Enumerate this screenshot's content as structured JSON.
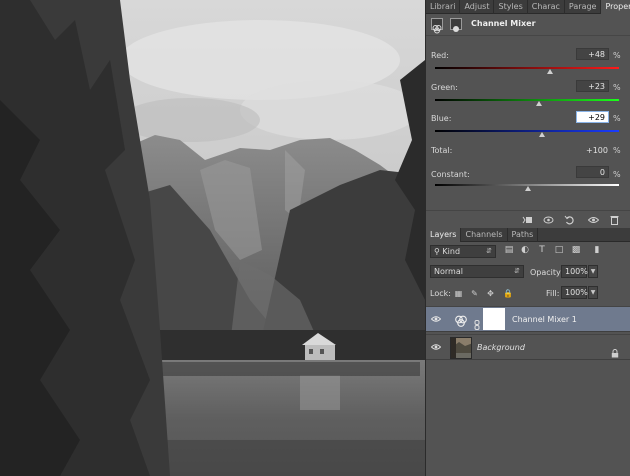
{
  "panel_tabs": [
    "Librari",
    "Adjust",
    "Styles",
    "Charac",
    "Parage",
    "Properties"
  ],
  "active_panel_tab": "Properties",
  "properties": {
    "title": "Channel Mixer",
    "channels": [
      {
        "label": "Red:",
        "value": "+48",
        "unit": "%",
        "slider_percent": 48,
        "gradient": [
          "#000000",
          "#ff1a1a"
        ]
      },
      {
        "label": "Green:",
        "value": "+23",
        "unit": "%",
        "slider_percent": 23,
        "gradient": [
          "#000000",
          "#1aff1a"
        ]
      },
      {
        "label": "Blue:",
        "value": "+29",
        "unit": "%",
        "slider_percent": 29,
        "gradient": [
          "#000000",
          "#1a3cff"
        ]
      }
    ],
    "total_label": "Total:",
    "total_value": "+100",
    "total_unit": "%",
    "constant_label": "Constant:",
    "constant_value": "0",
    "constant_unit": "%",
    "constant_slider_percent": 0,
    "footer_icons": [
      "clip-to-layer-icon",
      "view-previous-state-icon",
      "reset-icon",
      "visibility-icon",
      "trash-icon"
    ]
  },
  "layer_tabs": [
    "Layers",
    "Channels",
    "Paths"
  ],
  "active_layer_tab": "Layers",
  "layers_panel": {
    "filter_kind": "Kind",
    "blend_mode": "Normal",
    "opacity_label": "Opacity:",
    "opacity_value": "100%",
    "lock_label": "Lock:",
    "fill_label": "Fill:",
    "fill_value": "100%",
    "layers": [
      {
        "name": "Channel Mixer 1",
        "selected": true,
        "type": "adjustment"
      },
      {
        "name": "Background",
        "selected": false,
        "type": "image",
        "locked": true
      }
    ]
  },
  "colors": {
    "panel_bg": "#535353",
    "tab_bar": "#3c3c3c",
    "selected_layer": "#6f7a8e",
    "input_focus": "#ffffff"
  }
}
